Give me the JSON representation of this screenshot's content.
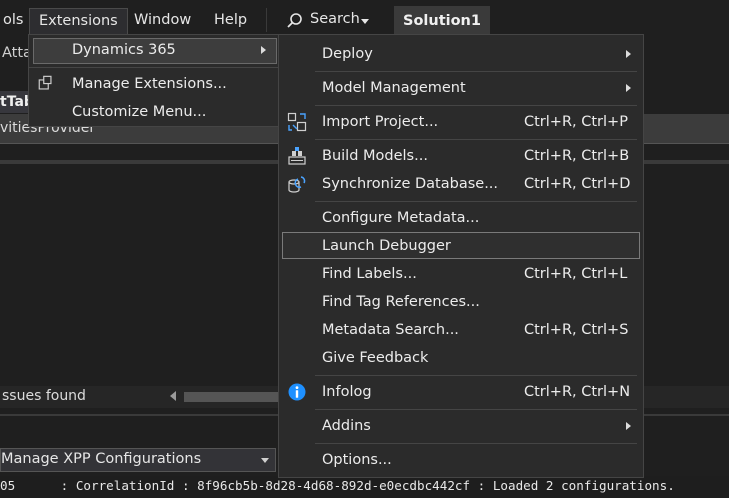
{
  "menubar": {
    "partial_first": "ols",
    "items": [
      "Extensions",
      "Window",
      "Help"
    ],
    "search_label": "Search",
    "solution_label": "Solution1"
  },
  "background": {
    "atta": "Atta",
    "tab_fragment": "tTab",
    "strip_text": "vitiesProvider",
    "issues_text": "ssues found",
    "config_combo": "Manage XPP Configurations",
    "status_line": "05      : CorrelationId : 8f96cb5b-8d28-4d68-892d-e0ecdbc442cf : Loaded 2 configurations."
  },
  "extensions_menu": {
    "items": [
      {
        "label": "Dynamics 365",
        "submenu": true
      },
      {
        "label": "Manage Extensions..."
      },
      {
        "label": "Customize Menu..."
      }
    ]
  },
  "dynamics_menu": {
    "items": [
      {
        "label": "Deploy",
        "submenu": true
      },
      {
        "label": "Model Management",
        "submenu": true
      },
      {
        "label": "Import Project...",
        "accel": "Ctrl+R, Ctrl+P",
        "icon": "import-project-icon"
      },
      {
        "label": "Build Models...",
        "accel": "Ctrl+R, Ctrl+B",
        "icon": "build-models-icon"
      },
      {
        "label": "Synchronize Database...",
        "accel": "Ctrl+R, Ctrl+D",
        "icon": "sync-database-icon"
      },
      {
        "label": "Configure Metadata..."
      },
      {
        "label": "Launch Debugger"
      },
      {
        "label": "Find Labels...",
        "accel": "Ctrl+R, Ctrl+L"
      },
      {
        "label": "Find Tag References..."
      },
      {
        "label": "Metadata Search...",
        "accel": "Ctrl+R, Ctrl+S"
      },
      {
        "label": "Give Feedback"
      },
      {
        "label": "Infolog",
        "accel": "Ctrl+R, Ctrl+N",
        "icon": "info-icon"
      },
      {
        "label": "Addins",
        "submenu": true
      },
      {
        "label": "Options..."
      }
    ]
  },
  "colors": {
    "background": "#1f1f1f",
    "menu_bg": "#2b2b2b",
    "info_blue": "#1e90ff"
  }
}
